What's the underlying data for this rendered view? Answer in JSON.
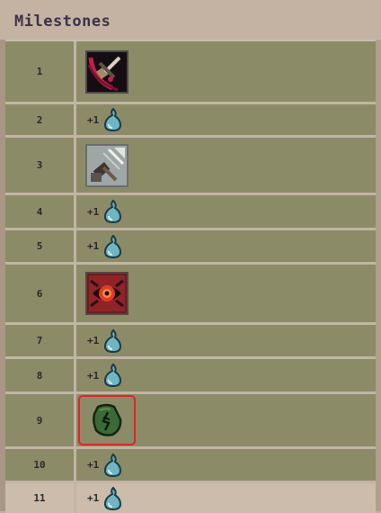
{
  "header": {
    "title": "Milestones"
  },
  "milestones": [
    {
      "level": "1",
      "reward": "item",
      "icon": "blade-strike-icon"
    },
    {
      "level": "2",
      "reward": "points",
      "amount": "+1",
      "icon": "droplet-icon"
    },
    {
      "level": "3",
      "reward": "item",
      "icon": "hammer-strike-icon"
    },
    {
      "level": "4",
      "reward": "points",
      "amount": "+1",
      "icon": "droplet-icon"
    },
    {
      "level": "5",
      "reward": "points",
      "amount": "+1",
      "icon": "droplet-icon"
    },
    {
      "level": "6",
      "reward": "item",
      "icon": "red-eye-icon"
    },
    {
      "level": "7",
      "reward": "points",
      "amount": "+1",
      "icon": "droplet-icon"
    },
    {
      "level": "8",
      "reward": "points",
      "amount": "+1",
      "icon": "droplet-icon"
    },
    {
      "level": "9",
      "reward": "item",
      "icon": "green-rune-stone-icon",
      "highlighted": true
    },
    {
      "level": "10",
      "reward": "points",
      "amount": "+1",
      "icon": "droplet-icon"
    },
    {
      "level": "11",
      "reward": "points",
      "amount": "+1",
      "icon": "droplet-icon"
    }
  ],
  "colors": {
    "row_bg": "#8b8b68",
    "row_bg_last": "#cbbcab",
    "highlight": "#e0252a",
    "droplet": "#6fb6c2"
  }
}
